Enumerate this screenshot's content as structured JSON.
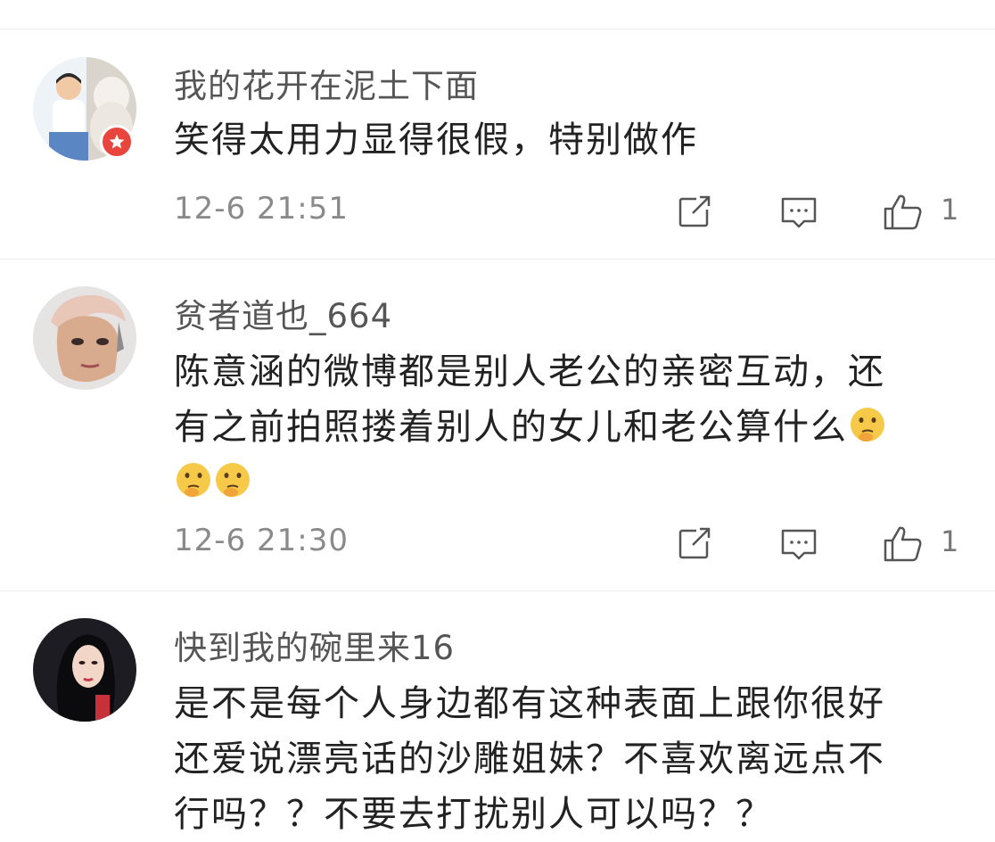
{
  "comments": [
    {
      "username": "我的花开在泥土下面",
      "text_lines": [
        "笑得太用力显得很假，特别做作"
      ],
      "time": "12-6 21:51",
      "likes": "1",
      "has_badge": true,
      "emoji_count": 0
    },
    {
      "username": "贫者道也_664",
      "text_lines": [
        "陈意涵的微博都是别人老公的亲密互动，还",
        "有之前拍照搂着别人的女儿和老公算什么"
      ],
      "time": "12-6 21:30",
      "likes": "1",
      "has_badge": false,
      "emoji_count": 3,
      "emoji_name": "thinking-face-emoji"
    },
    {
      "username": "快到我的碗里来16",
      "text_lines": [
        "是不是每个人身边都有这种表面上跟你很好",
        "还爱说漂亮话的沙雕姐妹？不喜欢离远点不",
        "行吗？？不要去打扰别人可以吗？？"
      ],
      "has_badge": false,
      "emoji_count": 0
    }
  ],
  "icons": {
    "share": "share-icon",
    "reply": "comment-icon",
    "like": "thumbs-up-icon",
    "badge": "star-badge-icon"
  },
  "colors": {
    "badge": "#e8453c",
    "meta_text": "#8a8a8a",
    "icon_stroke": "#555555"
  }
}
